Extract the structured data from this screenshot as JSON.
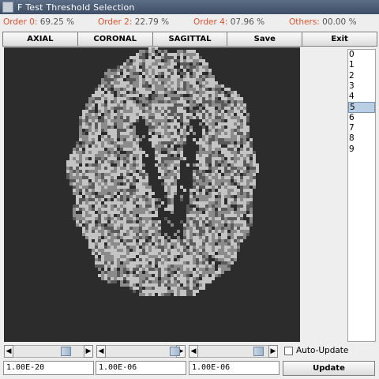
{
  "window": {
    "title": "F Test Threshold Selection"
  },
  "stats": [
    {
      "label": "Order 0:",
      "value": "69.25 %"
    },
    {
      "label": "Order 2:",
      "value": "22.79 %"
    },
    {
      "label": "Order 4:",
      "value": "07.96 %"
    },
    {
      "label": "Others:",
      "value": "00.00 %"
    }
  ],
  "toolbar": {
    "axial": "AXIAL",
    "coronal": "CORONAL",
    "sagittal": "SAGITTAL",
    "save": "Save",
    "exit": "Exit"
  },
  "slice_list": {
    "items": [
      "0",
      "1",
      "2",
      "3",
      "4",
      "5",
      "6",
      "7",
      "8",
      "9"
    ],
    "selected": "5"
  },
  "controls": {
    "auto_update_label": "Auto-Update",
    "auto_update_checked": false,
    "threshold_1": "1.00E-20",
    "threshold_2": "1.00E-06",
    "threshold_3": "1.00E-06",
    "update_button": "Update"
  },
  "colors": {
    "order_label": "#e0522f",
    "viewer_bg": "#2c2c2c",
    "list_selection": "#b8cfe5"
  }
}
